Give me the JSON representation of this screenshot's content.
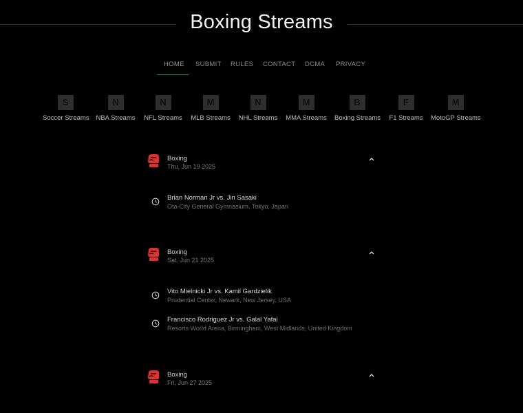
{
  "site": {
    "title": "Boxing Streams"
  },
  "nav": [
    {
      "label": "HOME"
    },
    {
      "label": "SUBMIT"
    },
    {
      "label": "RULES"
    },
    {
      "label": "CONTACT"
    },
    {
      "label": "DCMA"
    },
    {
      "label": "PRIVACY"
    }
  ],
  "sports": [
    {
      "letter": "S",
      "label": "Soccer Streams"
    },
    {
      "letter": "N",
      "label": "NBA Streams"
    },
    {
      "letter": "N",
      "label": "NFL Streams"
    },
    {
      "letter": "M",
      "label": "MLB Streams"
    },
    {
      "letter": "N",
      "label": "NHL Streams"
    },
    {
      "letter": "M",
      "label": "MMA Streams"
    },
    {
      "letter": "B",
      "label": "Boxing Streams"
    },
    {
      "letter": "F",
      "label": "F1 Streams"
    },
    {
      "letter": "M",
      "label": "MotoGP Streams"
    }
  ],
  "schedule": [
    {
      "sport": "Boxing",
      "date": "Thu, Jun 19 2025",
      "events": [
        {
          "name": "Brian Norman Jr vs. Jin Sasaki",
          "venue": "Ota-City General Gymnasium, Tokyo, Japan"
        }
      ]
    },
    {
      "sport": "Boxing",
      "date": "Sat, Jun 21 2025",
      "events": [
        {
          "name": "Vito Mielnicki Jr vs. Kamil Gardzielik",
          "venue": "Prudential Center, Newark, New Jersey, USA"
        },
        {
          "name": "Francisco Rodriguez Jr vs. Galal Yafai",
          "venue": "Resorts World Arena, Birmingham, West Midlands, United Kingdom"
        }
      ]
    },
    {
      "sport": "Boxing",
      "date": "Fri, Jun 27 2025",
      "events": []
    }
  ],
  "colors": {
    "accent": "#2c7a4a",
    "glove": "#e03030"
  }
}
